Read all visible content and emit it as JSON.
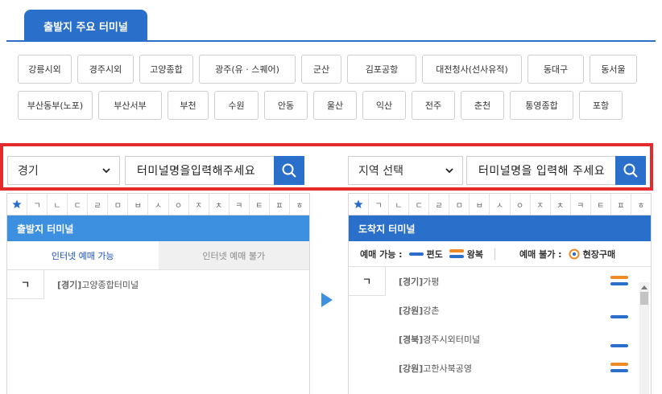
{
  "header": {
    "tab_label": "출발지 주요 터미널"
  },
  "major_terminals": {
    "row1": [
      "강릉시외",
      "경주시외",
      "고양종합",
      "광주(유 · 스퀘어)",
      "군산",
      "김포공항",
      "대전청사(선사유적)",
      "동대구",
      "동서울"
    ],
    "row2": [
      "부산동부(노포)",
      "부산서부",
      "부천",
      "수원",
      "안동",
      "울산",
      "익산",
      "전주",
      "춘천",
      "통영종합",
      "포항"
    ]
  },
  "search": {
    "departure_region": "경기",
    "departure_placeholder": "터미널명을입력해주세요",
    "arrival_region": "지역 선택",
    "arrival_placeholder": "터미널명을 입력해 주세요"
  },
  "consonants": [
    "ㄱ",
    "ㄴ",
    "ㄷ",
    "ㄹ",
    "ㅁ",
    "ㅂ",
    "ㅅ",
    "ㅇ",
    "ㅈ",
    "ㅊ",
    "ㅋ",
    "ㅌ",
    "ㅍ",
    "ㅎ"
  ],
  "departure_panel": {
    "title": "출발지 터미널",
    "tab_available": "인터넷 예매 가능",
    "tab_unavailable": "인터넷 예매 불가",
    "initial": "ㄱ",
    "terminal_region": "[경기]",
    "terminal_name": "고양종합터미널"
  },
  "arrival_panel": {
    "title": "도착지 터미널",
    "legend_available": "예매 가능 :",
    "legend_oneway": "편도",
    "legend_roundtrip": "왕복",
    "legend_unavailable": "예매 불가 :",
    "legend_onsite": "현장구매",
    "initial": "ㄱ",
    "terminals": [
      {
        "region": "[경기]",
        "name": "가평",
        "type": "roundtrip"
      },
      {
        "region": "[강원]",
        "name": "강촌",
        "type": "oneway"
      },
      {
        "region": "[경북]",
        "name": "경주시외터미널",
        "type": "oneway"
      },
      {
        "region": "[강원]",
        "name": "고한사북공영",
        "type": "roundtrip"
      }
    ]
  },
  "colors": {
    "primary": "#2a6fc9",
    "panel_light": "#3d8fe0",
    "highlight": "#e42a2a",
    "orange": "#f08a24",
    "star": "#2a6fc9"
  }
}
